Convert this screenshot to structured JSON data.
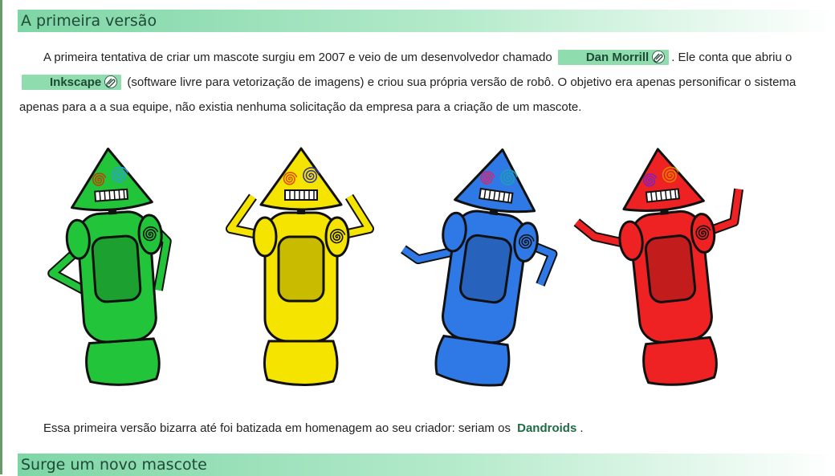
{
  "sections": [
    {
      "title": "A primeira versão"
    },
    {
      "title": "Surge um novo mascote"
    }
  ],
  "paragraph1": {
    "text_a": "A primeira tentativa de criar um mascote surgiu em 2007 e veio de um desenvolvedor chamado",
    "link1_label": "Dan Morrill",
    "text_b": ". Ele conta que abriu o",
    "link2_label": "Inkscape",
    "text_c": "(software livre para vetorização de imagens) e criou sua própria versão de robô. O objetivo era apenas personificar o sistema apenas para a a sua equipe, não existia nenhuma solicitação da empresa para a criação de um mascote."
  },
  "paragraph2": {
    "text_a": "Essa primeira versão bizarra até foi batizada em homenagem ao seu criador: seriam os",
    "highlight": "Dandroids",
    "text_b": "."
  },
  "image": {
    "robot_colors": [
      "#22c43a",
      "#f5e400",
      "#2f79e6",
      "#ee2222"
    ],
    "icon_names": [
      "paperclip-icon"
    ]
  }
}
